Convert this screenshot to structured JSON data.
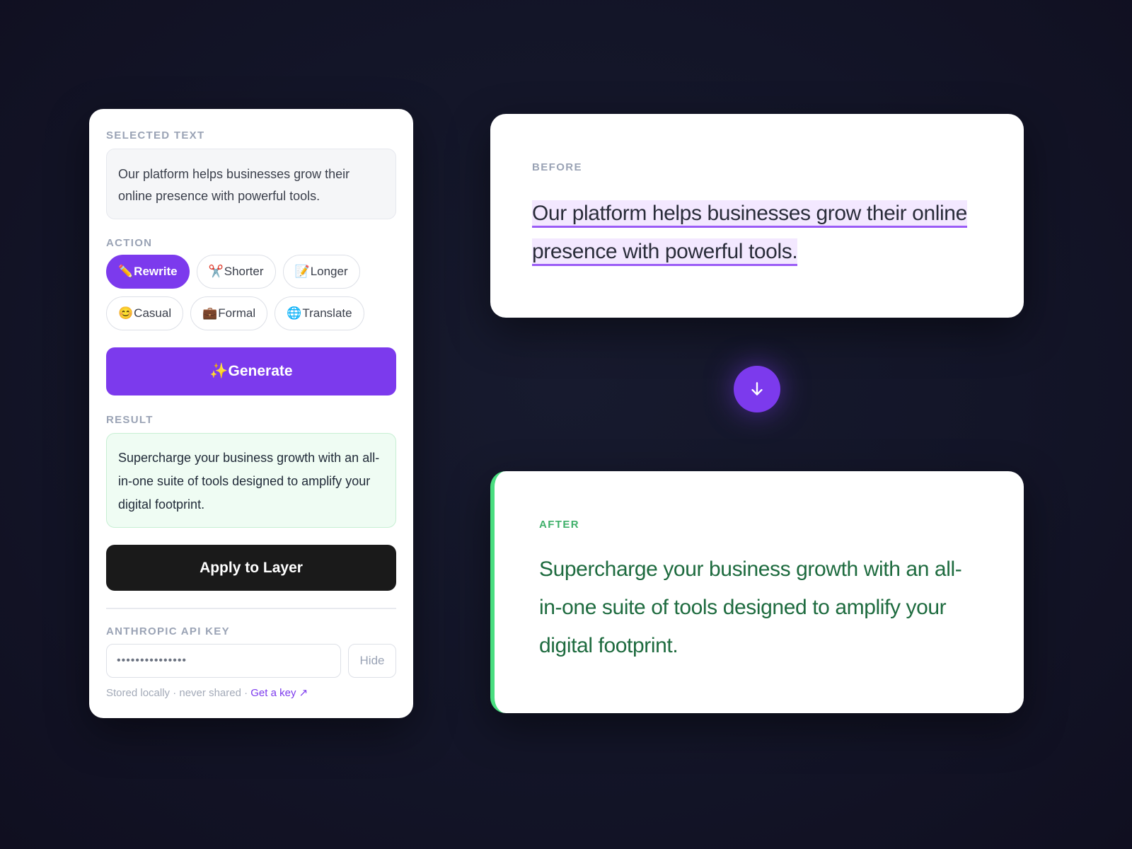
{
  "panel": {
    "selected_label": "SELECTED TEXT",
    "selected_text": "Our platform helps businesses grow their online presence with powerful tools.",
    "action_label": "ACTION",
    "actions": [
      {
        "emoji": "✏️",
        "label": "Rewrite",
        "active": true
      },
      {
        "emoji": "✂️",
        "label": "Shorter",
        "active": false
      },
      {
        "emoji": "📝",
        "label": "Longer",
        "active": false
      },
      {
        "emoji": "😊",
        "label": "Casual",
        "active": false
      },
      {
        "emoji": "💼",
        "label": "Formal",
        "active": false
      },
      {
        "emoji": "🌐",
        "label": "Translate",
        "active": false
      }
    ],
    "generate_label": "✨Generate",
    "result_label": "RESULT",
    "result_text": "Supercharge your business growth with an all-in-one suite of tools designed to amplify your digital footprint.",
    "apply_label": "Apply to Layer",
    "api_key_label": "ANTHROPIC API KEY",
    "api_key_value": "•••••••••••••••",
    "hide_label": "Hide",
    "stored_note": "Stored locally · never shared ·",
    "get_key_label": "Get a key ↗"
  },
  "before": {
    "label": "BEFORE",
    "line1": "Our platform helps businesses grow their online",
    "line2": "presence with powerful tools."
  },
  "arrow": {
    "icon": "arrow-down-icon"
  },
  "after": {
    "label": "AFTER",
    "text": "Supercharge your business growth with an all-in-one suite of tools designed to amplify your digital footprint."
  },
  "colors": {
    "accent": "#7c3aed",
    "dark_button": "#1a1a1a",
    "after_accent": "#4ade80",
    "after_text": "#1e6b3f",
    "background": "#131528"
  }
}
